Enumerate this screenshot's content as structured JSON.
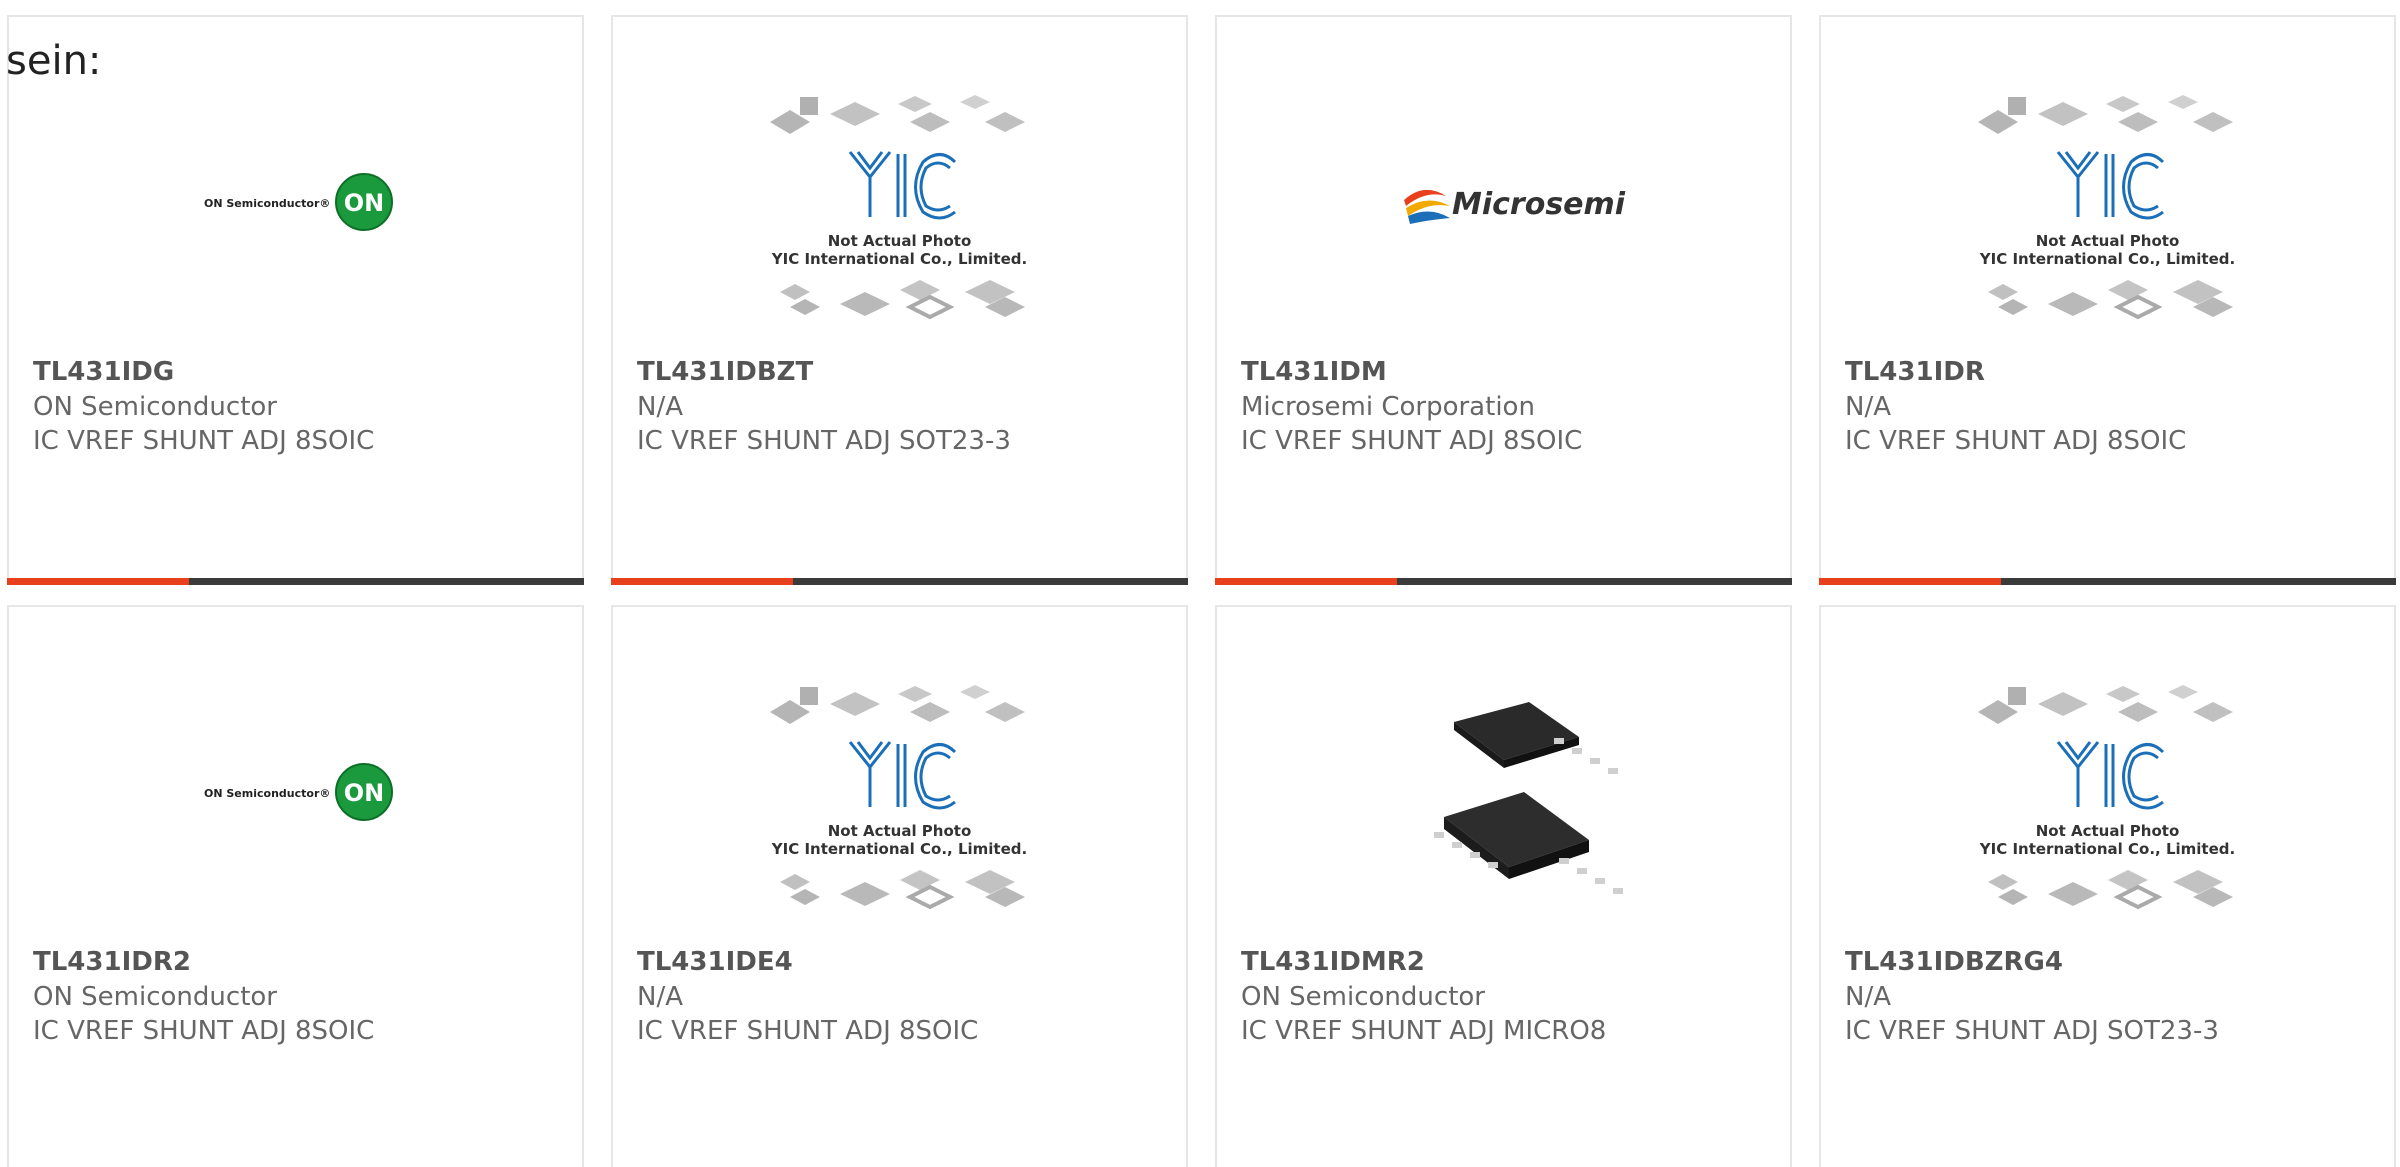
{
  "lead_text": "sein:",
  "colors": {
    "accent": "#e8401c",
    "bar": "#3a3a3a",
    "on_green": "#1a9a3c",
    "yic_blue": "#1b6fb8"
  },
  "placeholder": {
    "line1": "Not Actual Photo",
    "line2": "YIC International Co., Limited."
  },
  "logos": {
    "on_text": "ON Semiconductor®",
    "on_badge": "ON",
    "microsemi_text": "Microsemi"
  },
  "products": [
    {
      "part": "TL431IDG",
      "maker": "ON Semiconductor",
      "desc": "IC VREF SHUNT ADJ 8SOIC",
      "image": "on-logo"
    },
    {
      "part": "TL431IDBZT",
      "maker": "N/A",
      "desc": "IC VREF SHUNT ADJ SOT23-3",
      "image": "yic-placeholder"
    },
    {
      "part": "TL431IDM",
      "maker": "Microsemi Corporation",
      "desc": "IC VREF SHUNT ADJ 8SOIC",
      "image": "microsemi-logo"
    },
    {
      "part": "TL431IDR",
      "maker": "N/A",
      "desc": "IC VREF SHUNT ADJ 8SOIC",
      "image": "yic-placeholder"
    },
    {
      "part": "TL431IDR2",
      "maker": "ON Semiconductor",
      "desc": "IC VREF SHUNT ADJ 8SOIC",
      "image": "on-logo"
    },
    {
      "part": "TL431IDE4",
      "maker": "N/A",
      "desc": "IC VREF SHUNT ADJ 8SOIC",
      "image": "yic-placeholder"
    },
    {
      "part": "TL431IDMR2",
      "maker": "ON Semiconductor",
      "desc": "IC VREF SHUNT ADJ MICRO8",
      "image": "chip-photo"
    },
    {
      "part": "TL431IDBZRG4",
      "maker": "N/A",
      "desc": "IC VREF SHUNT ADJ SOT23-3",
      "image": "yic-placeholder"
    }
  ]
}
